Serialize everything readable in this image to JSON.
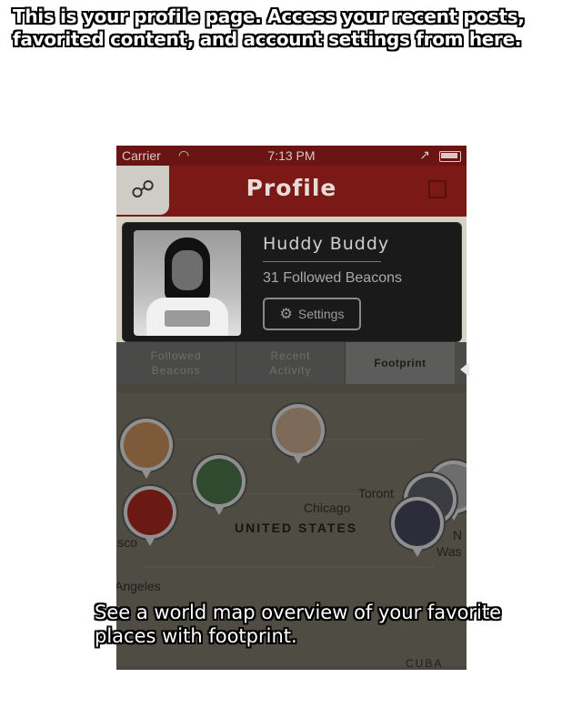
{
  "captions": {
    "top": "This is your profile page. Access your recent posts, favorited content, and account settings from here.",
    "bottom": "See a world map overview of your favorite places with footprint."
  },
  "status_bar": {
    "carrier": "Carrier",
    "time": "7:13 PM"
  },
  "navbar": {
    "title": "Profile"
  },
  "profile": {
    "name": "Huddy Buddy",
    "followed": "31 Followed Beacons",
    "settings_label": "Settings"
  },
  "tabs": [
    {
      "label": "Followed\nBeacons"
    },
    {
      "label": "Recent\nActivity"
    },
    {
      "label": "Footprint"
    }
  ],
  "map": {
    "labels": {
      "toronto": "Toront",
      "chicago": "Chicago",
      "united_states": "UNITED STATES",
      "san_francisco": "isco",
      "los_angeles": "Angeles",
      "new_york": "N",
      "washington": "Was",
      "cuba": "CUBA"
    }
  },
  "colors": {
    "nav_red": "#7a1915",
    "status_red": "#6a1513",
    "overlay": "rgba(0,0,0,0.72)"
  }
}
